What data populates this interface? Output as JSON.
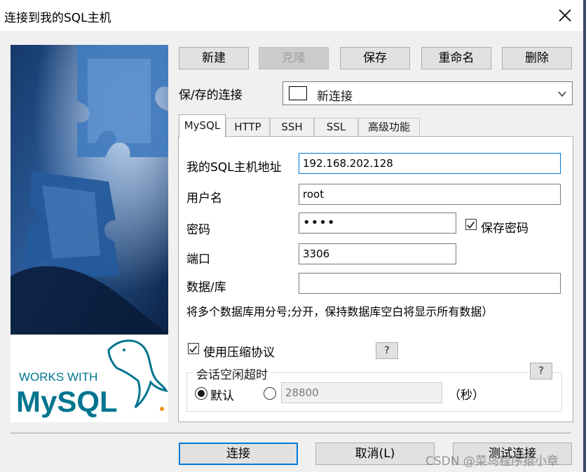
{
  "window": {
    "title": "连接到我的SQL主机",
    "close_icon": "close-icon"
  },
  "banner": {
    "logo_top": "WORKS WITH",
    "logo_bottom": "MySQL",
    "colors": {
      "photo_dark": "#0d2a52",
      "photo_light": "#7ea6d8",
      "logo_blue": "#00758f",
      "logo_orange": "#f29111"
    }
  },
  "toolbar": {
    "new_label": "新建",
    "clone_label": "克隆",
    "save_label": "保存",
    "rename_label": "重命名",
    "delete_label": "删除"
  },
  "saved_connections": {
    "label": "保/存的连接",
    "selected": "新连接"
  },
  "tabs": [
    {
      "label": "MySQL",
      "active": true
    },
    {
      "label": "HTTP",
      "active": false
    },
    {
      "label": "SSH",
      "active": false
    },
    {
      "label": "SSL",
      "active": false
    },
    {
      "label": "高级功能",
      "active": false
    }
  ],
  "form": {
    "host_label": "我的SQL主机地址",
    "host_value": "192.168.202.128",
    "user_label": "用户名",
    "user_value": "root",
    "password_label": "密码",
    "password_value": "••••",
    "save_password_label": "保存密码",
    "save_password_checked": true,
    "port_label": "端口",
    "port_value": "3306",
    "database_label": "数据/库",
    "database_value": "",
    "hint": "将多个数据库用分号;分开，保持数据库空白将显示所有数据）",
    "compression_label": "使用压缩协议",
    "compression_checked": true,
    "help_label": "?"
  },
  "timeout": {
    "title": "会话空闲超时",
    "default_label": "默认",
    "custom_value": "28800",
    "unit_label": "（秒）",
    "help_label": "?"
  },
  "footer": {
    "connect_label": "连接",
    "cancel_label": "取消(L)",
    "test_label": "测试连接"
  },
  "watermark": "CSDN @菜鸟程序猿小章",
  "colors": {
    "accent": "#0078d7",
    "window_bg": "#f0f0f0",
    "button_bg": "#e1e1e1"
  }
}
